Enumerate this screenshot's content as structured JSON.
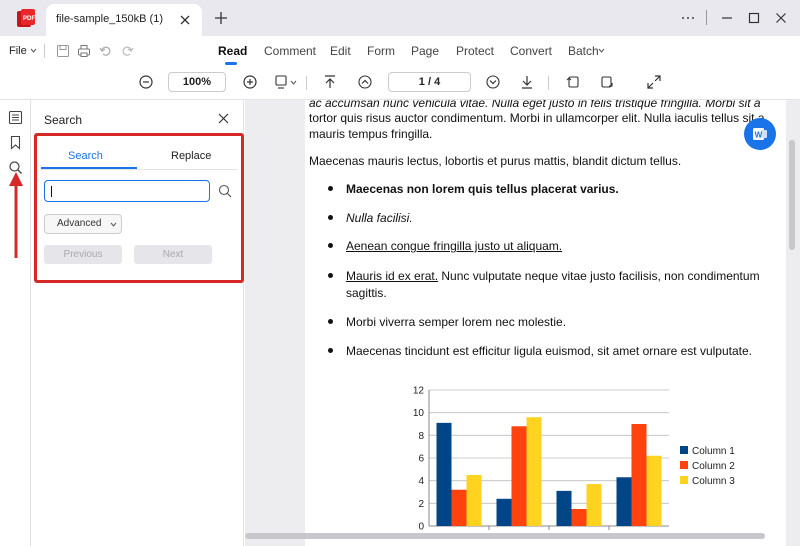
{
  "tab": {
    "title": "file-sample_150kB (1)"
  },
  "menu": {
    "file_label": "File",
    "tabs": [
      "Read",
      "Comment",
      "Edit",
      "Form",
      "Page",
      "Protect",
      "Convert",
      "Batch"
    ]
  },
  "toolbar": {
    "zoom": "100%",
    "page": "1 / 4"
  },
  "search_panel": {
    "title": "Search",
    "tab_search": "Search",
    "tab_replace": "Replace",
    "input_value": "",
    "advanced_label": "Advanced",
    "previous_label": "Previous",
    "next_label": "Next"
  },
  "document": {
    "para1_line1": "ac accumsan nunc vehicula vitae. Nulla eget justo in felis tristique fringilla. Morbi sit a",
    "para1_line2": "tortor quis risus auctor condimentum. Morbi in ullamcorper elit. Nulla iaculis tellus sit a",
    "para1_line3": "mauris tempus fringilla.",
    "para2": "Maecenas mauris lectus, lobortis et purus mattis, blandit dictum tellus.",
    "bullets": [
      "Maecenas non lorem quis tellus placerat varius.",
      "Nulla facilisi.",
      "Aenean congue fringilla justo ut aliquam.",
      "Mauris id ex erat.",
      " Nunc vulputate neque vitae justo facilisis, non condimentum",
      "sagittis.",
      "Morbi viverra semper lorem nec molestie.",
      "Maecenas tincidunt est efficitur ligula euismod, sit amet ornare est vulputate."
    ]
  },
  "colors": {
    "accent": "#1a73e8",
    "highlight": "#d62828",
    "col1": "#004586",
    "col2": "#ff420e",
    "col3": "#ffd320"
  },
  "chart_data": {
    "type": "bar",
    "categories": [
      "",
      "",
      "",
      ""
    ],
    "series": [
      {
        "name": "Column 1",
        "values": [
          9.1,
          2.4,
          3.1,
          4.3
        ]
      },
      {
        "name": "Column 2",
        "values": [
          3.2,
          8.8,
          1.5,
          9.0
        ]
      },
      {
        "name": "Column 3",
        "values": [
          4.5,
          9.6,
          3.7,
          6.2
        ]
      }
    ],
    "ylim": [
      0,
      12
    ],
    "yticks": [
      "0",
      "2",
      "4",
      "6",
      "8",
      "10",
      "12"
    ],
    "legend": "right",
    "grid": true
  }
}
